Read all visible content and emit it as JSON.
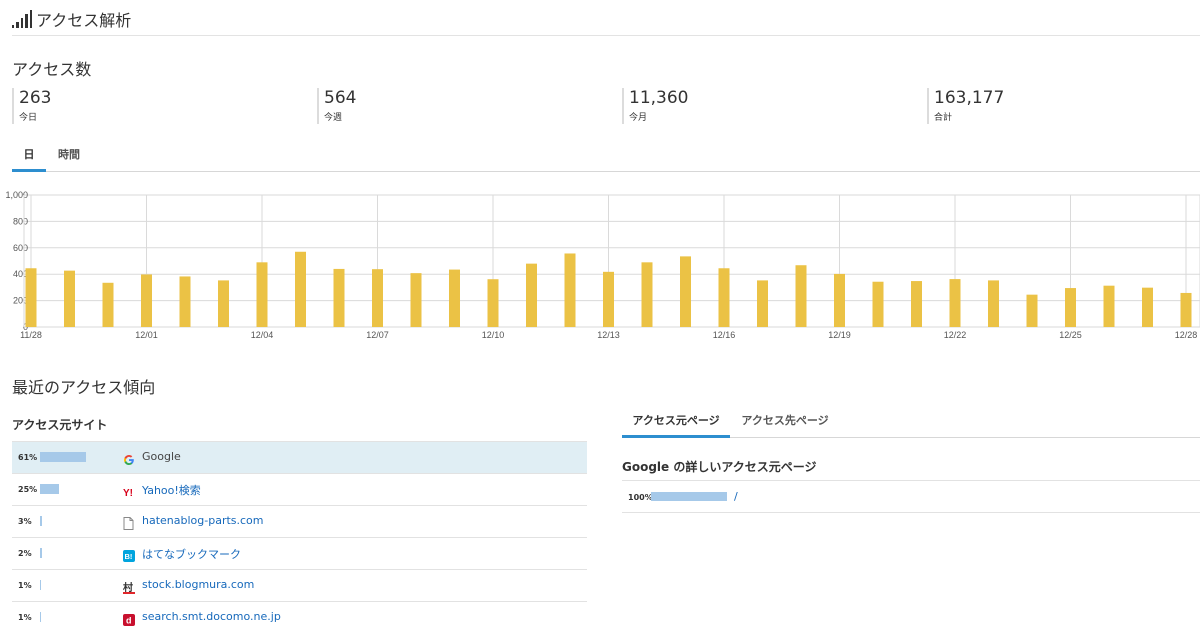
{
  "header": {
    "title": "アクセス解析",
    "icon": "signal-bars-icon"
  },
  "access_count": {
    "title": "アクセス数",
    "stats": [
      {
        "value": "263",
        "label": "今日"
      },
      {
        "value": "564",
        "label": "今週"
      },
      {
        "value": "11,360",
        "label": "今月"
      },
      {
        "value": "163,177",
        "label": "合計"
      }
    ]
  },
  "period_tabs": [
    {
      "label": "日",
      "active": true
    },
    {
      "label": "時間",
      "active": false
    }
  ],
  "chart_data": {
    "type": "bar",
    "x_tick_labels": [
      "11/28",
      "12/01",
      "12/04",
      "12/07",
      "12/10",
      "12/13",
      "12/16",
      "12/19",
      "12/22",
      "12/25",
      "12/28"
    ],
    "categories": [
      "11/28",
      "11/29",
      "11/30",
      "12/01",
      "12/02",
      "12/03",
      "12/04",
      "12/05",
      "12/06",
      "12/07",
      "12/08",
      "12/09",
      "12/10",
      "12/11",
      "12/12",
      "12/13",
      "12/14",
      "12/15",
      "12/16",
      "12/17",
      "12/18",
      "12/19",
      "12/20",
      "12/21",
      "12/22",
      "12/23",
      "12/24",
      "12/25",
      "12/26",
      "12/27",
      "12/28"
    ],
    "values": [
      445,
      427,
      335,
      398,
      383,
      353,
      490,
      570,
      440,
      438,
      408,
      435,
      362,
      480,
      557,
      418,
      490,
      535,
      445,
      353,
      468,
      402,
      343,
      348,
      363,
      353,
      245,
      295,
      313,
      298,
      258
    ],
    "y_tick_labels": [
      "0",
      "200",
      "400",
      "600",
      "800",
      "1,000"
    ],
    "ylim": [
      0,
      1000
    ],
    "color": "#ebc245",
    "grid": true
  },
  "recent": {
    "title": "最近のアクセス傾向",
    "sources_title": "アクセス元サイト",
    "sources": [
      {
        "pct": "61%",
        "share": 0.61,
        "name": "Google",
        "icon": "google-icon",
        "selected": true
      },
      {
        "pct": "25%",
        "share": 0.25,
        "name": "Yahoo!検索",
        "icon": "yahoo-icon",
        "selected": false
      },
      {
        "pct": "3%",
        "share": 0.03,
        "name": "hatenablog-parts.com",
        "icon": "page-icon",
        "selected": false
      },
      {
        "pct": "2%",
        "share": 0.02,
        "name": "はてなブックマーク",
        "icon": "hatena-bookmark-icon",
        "selected": false
      },
      {
        "pct": "1%",
        "share": 0.01,
        "name": "stock.blogmura.com",
        "icon": "blogmura-icon",
        "selected": false
      },
      {
        "pct": "1%",
        "share": 0.01,
        "name": "search.smt.docomo.ne.jp",
        "icon": "docomo-icon",
        "selected": false
      }
    ],
    "page_tabs": [
      {
        "label": "アクセス元ページ",
        "active": true
      },
      {
        "label": "アクセス先ページ",
        "active": false
      }
    ],
    "detail_title": "Google の詳しいアクセス元ページ",
    "detail_rows": [
      {
        "pct": "100%",
        "share": 1.0,
        "path": "/"
      }
    ]
  }
}
